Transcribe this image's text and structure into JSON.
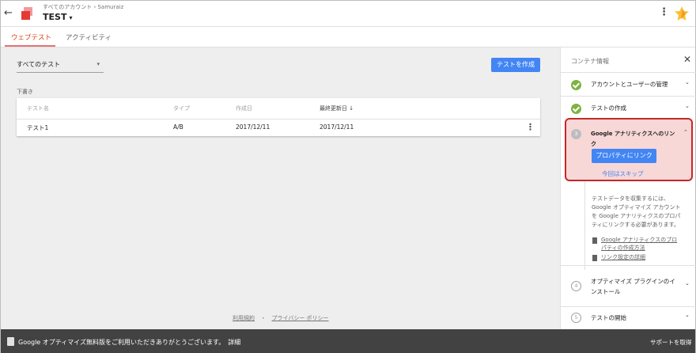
{
  "header": {
    "back_glyph": "←",
    "breadcrumb": "すべてのアカウント › Samuraiz",
    "title": "TEST",
    "title_caret": "▾",
    "menu_glyph": "⋮"
  },
  "tabs": [
    {
      "label": "ウェブテスト",
      "active": true
    },
    {
      "label": "アクティビティ",
      "active": false
    }
  ],
  "toolbar": {
    "filter_value": "すべてのテスト",
    "filter_caret": "▾",
    "create_label": "テストを作成"
  },
  "drafts": {
    "section_label": "下書き",
    "columns": [
      "テスト名",
      "タイプ",
      "作成日",
      "最終更新日 ↓"
    ],
    "rows": [
      {
        "name": "テスト1",
        "type": "A/B",
        "created": "2017/12/11",
        "updated": "2017/12/11"
      }
    ],
    "row_menu": "⋮"
  },
  "footer": {
    "terms": "利用規約",
    "sep": "・",
    "privacy": "プライバシー ポリシー"
  },
  "panel": {
    "title": "コンテナ情報",
    "close_glyph": "✕",
    "steps": [
      {
        "label": "アカウントとユーザーの管理",
        "state": "done",
        "chevron": "⌄"
      },
      {
        "label": "テストの作成",
        "state": "done",
        "chevron": "⌄"
      },
      {
        "number": "3",
        "label": "Google アナリティクスへのリンク",
        "state": "active",
        "chevron": "⌃"
      },
      {
        "number": "4",
        "label": "オプティマイズ プラグインのインストール",
        "state": "pending",
        "chevron": "⌄"
      },
      {
        "number": "5",
        "label": "テストの開始",
        "state": "pending",
        "chevron": "⌄"
      }
    ],
    "link_button": "プロパティにリンク",
    "skip_label": "今回はスキップ",
    "info_text": "テストデータを収集するには、Google オプティマイズ アカウントを Google アナリティクスのプロパティにリンクする必要があります。",
    "doc_links": [
      "Google アナリティクスのプロパティの作成方法",
      "リンク設定の詳細"
    ]
  },
  "bottom_bar": {
    "message": "Google オプティマイズ無料版をご利用いただきありがとうございます。",
    "detail_link": "詳細",
    "support": "サポートを取得"
  },
  "colors": {
    "accent": "#4285f4",
    "tab_active": "#d84315",
    "highlight_border": "#c62828",
    "done_green": "#7cb342",
    "bottom_bar": "#424242"
  }
}
